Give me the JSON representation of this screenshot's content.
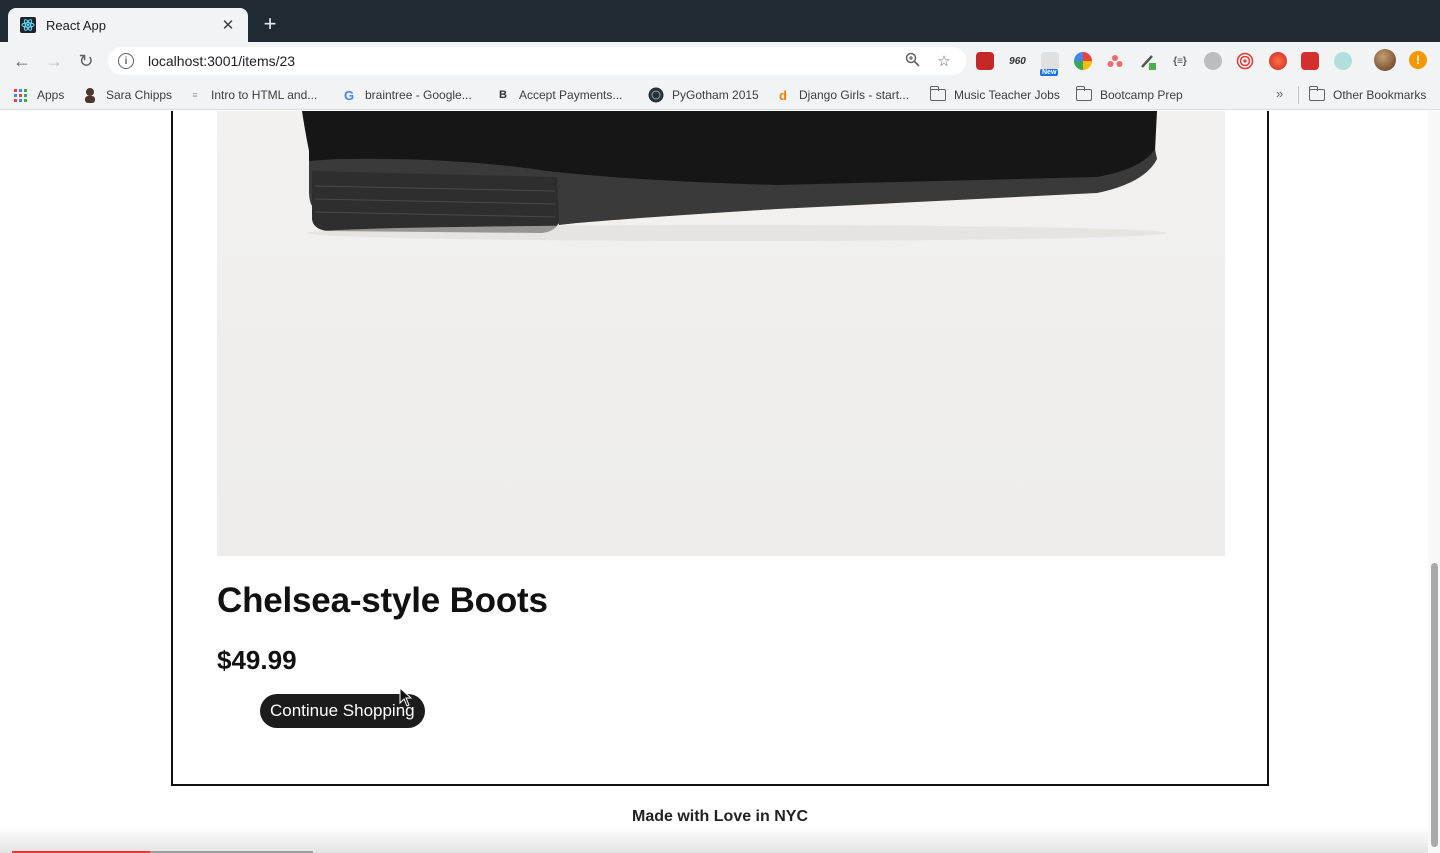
{
  "browser": {
    "tab": {
      "title": "React App",
      "close_glyph": "✕"
    },
    "new_tab_glyph": "+",
    "url": "localhost:3001/items/23",
    "nav": {
      "back_glyph": "←",
      "forward_glyph": "→",
      "reload_glyph": "↻"
    },
    "omnibox_icons": [
      "zoom-icon",
      "star-icon"
    ],
    "extension_icons": [
      "bookmark-red-icon",
      "960-icon",
      "new-badge-icon",
      "pinwheel-icon",
      "asana-icon",
      "color-picker-icon",
      "json-icon",
      "cookie-icon",
      "target-icon",
      "fruit-icon",
      "pdf-icon",
      "ghost-icon"
    ],
    "extension_labels": {
      "960-icon": "960",
      "new-badge-icon": "New",
      "json-icon": "{≡}"
    },
    "alert_glyph": "!"
  },
  "bookmarks": {
    "items": [
      {
        "label": "Apps",
        "icon": "apps-grid-icon"
      },
      {
        "label": "Sara Chipps",
        "icon": "person-icon"
      },
      {
        "label": "Intro to HTML and...",
        "icon": "page-icon"
      },
      {
        "label": "braintree - Google...",
        "icon": "google-icon"
      },
      {
        "label": "Accept Payments...",
        "icon": "b-icon"
      },
      {
        "label": "PyGotham 2015",
        "icon": "globe-icon"
      },
      {
        "label": "Django Girls - start...",
        "icon": "d-icon"
      },
      {
        "label": "Music Teacher Jobs",
        "icon": "folder-icon"
      },
      {
        "label": "Bootcamp Prep",
        "icon": "folder-icon"
      }
    ],
    "overflow_glyph": "»",
    "other_bookmarks": "Other Bookmarks"
  },
  "product": {
    "title": "Chelsea-style Boots",
    "price": "$49.99",
    "continue_label": "Continue Shopping",
    "image_alt": "boot-image"
  },
  "footer": {
    "text": "Made with Love in NYC"
  },
  "colors": {
    "tabstrip": "#1f2a33",
    "toolbar": "#f1f3f4",
    "button_bg": "#1c1c1c",
    "card_border": "#111111"
  }
}
